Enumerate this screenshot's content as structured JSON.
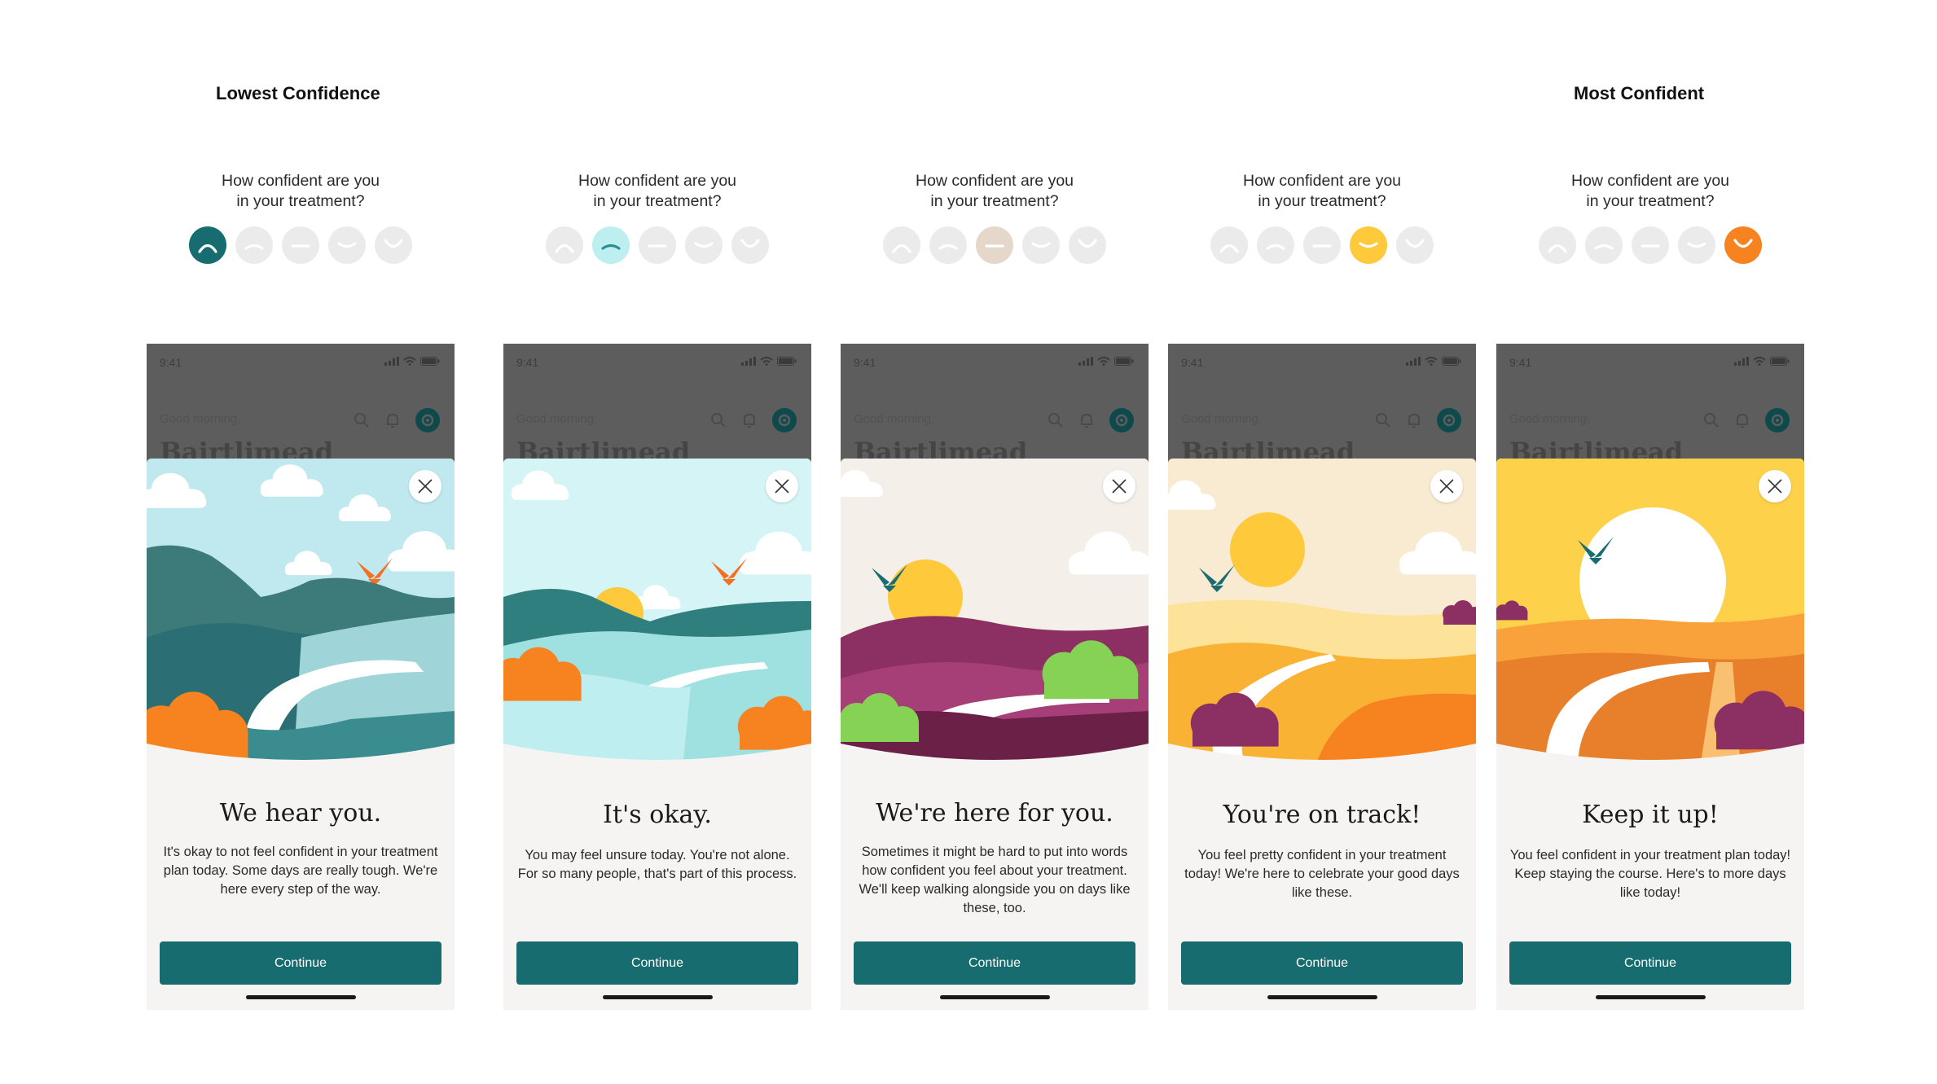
{
  "labels": {
    "lowest": "Lowest Confidence",
    "most": "Most Confident"
  },
  "question": "How confident are you\nin your treatment?",
  "status_time": "9:41",
  "greeting": "Good morning,",
  "app_name": "Bairtlimead",
  "continue_label": "Continue",
  "face_icons": [
    "very-sad-face-icon",
    "sad-face-icon",
    "neutral-face-icon",
    "happy-face-icon",
    "very-happy-face-icon"
  ],
  "colors": {
    "face_inactive": "#ebebeb",
    "face_selected": [
      "#166c6f",
      "#bdeef0",
      "#e5d8cb",
      "#fec93b",
      "#f6831f"
    ],
    "button": "#166c6f"
  },
  "screens": [
    {
      "selected_rating": 1,
      "title": "We hear you.",
      "body": "It's okay to not feel confident in your treatment plan today. Some days are really tough. We're here every step of the way."
    },
    {
      "selected_rating": 2,
      "title": "It's okay.",
      "body": "You may feel unsure today. You're not alone. For so many people, that's part of this process."
    },
    {
      "selected_rating": 3,
      "title": "We're here for you.",
      "body": "Sometimes it might be hard to put into words how confident you feel about your treatment. We'll keep walking alongside you on days like these, too."
    },
    {
      "selected_rating": 4,
      "title": "You're on track!",
      "body": "You feel pretty confident in your treatment today! We're here to celebrate your good days like these."
    },
    {
      "selected_rating": 5,
      "title": "Keep it up!",
      "body": "You feel confident in your treatment plan today! Keep staying the course. Here's to more days like today!"
    }
  ]
}
